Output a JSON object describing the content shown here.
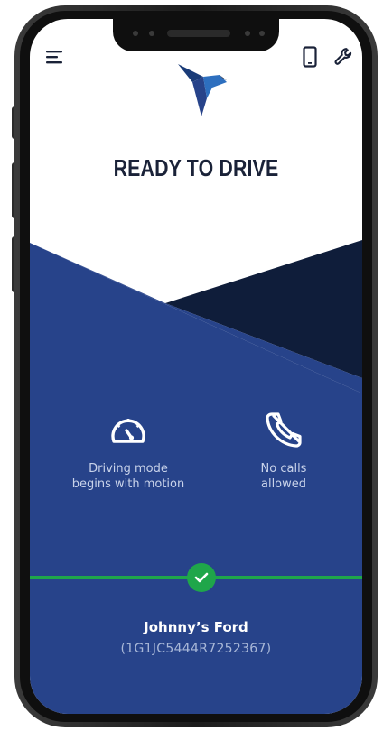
{
  "header": {
    "menu_icon": "hamburger-menu-icon",
    "device_icon": "phone-device-icon",
    "settings_icon": "wrench-icon"
  },
  "brand": {
    "logo_icon": "bird-logo-icon"
  },
  "status": {
    "title": "READY TO DRIVE"
  },
  "features": [
    {
      "icon": "speedometer-icon",
      "line1": "Driving mode",
      "line2": "begins with motion"
    },
    {
      "icon": "phone-blocked-icon",
      "line1": "No calls",
      "line2": "allowed"
    }
  ],
  "vehicle": {
    "name": "Johnny’s Ford",
    "vin": "(1G1JC5444R7252367)",
    "connected_icon": "checkmark-icon"
  },
  "colors": {
    "primary_blue": "#27438a",
    "dark_navy": "#0f1d3a",
    "accent_green": "#1fa64a",
    "title_text": "#1a2238"
  }
}
